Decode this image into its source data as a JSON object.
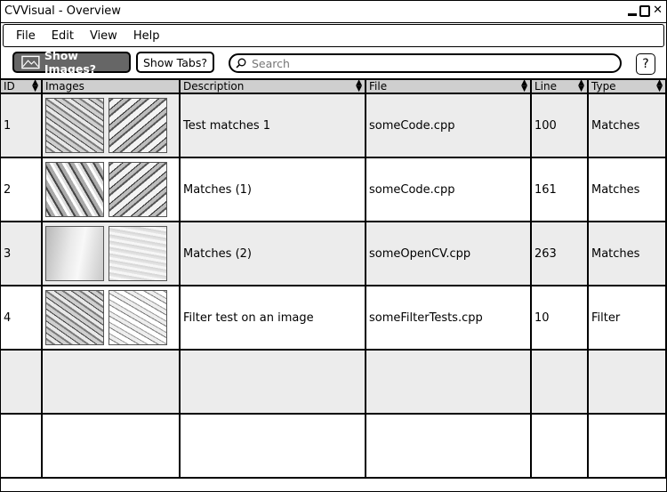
{
  "window": {
    "title": "CVVisual - Overview"
  },
  "menu": [
    "File",
    "Edit",
    "View",
    "Help"
  ],
  "toolbar": {
    "show_images_label": "Show Images?",
    "show_tabs_label": "Show Tabs?",
    "search_placeholder": "Search",
    "help_label": "?"
  },
  "table": {
    "columns": [
      "ID",
      "Images",
      "Description",
      "File",
      "Line",
      "Type"
    ],
    "rows": [
      {
        "id": "1",
        "description": "Test matches 1",
        "file": "someCode.cpp",
        "line": "100",
        "type": "Matches"
      },
      {
        "id": "2",
        "description": "Matches (1)",
        "file": "someCode.cpp",
        "line": "161",
        "type": "Matches"
      },
      {
        "id": "3",
        "description": "Matches (2)",
        "file": "someOpenCV.cpp",
        "line": "263",
        "type": "Matches"
      },
      {
        "id": "4",
        "description": "Filter test on an image",
        "file": "someFilterTests.cpp",
        "line": "10",
        "type": "Filter"
      }
    ]
  }
}
